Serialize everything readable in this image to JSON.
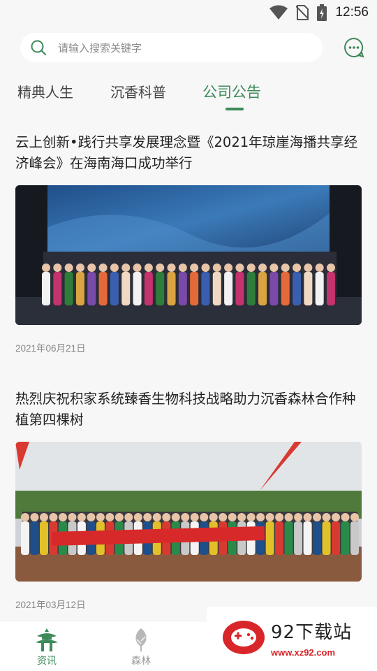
{
  "status_bar": {
    "time": "12:56",
    "icons": [
      "wifi-icon",
      "no-sim-icon",
      "battery-icon"
    ]
  },
  "search": {
    "placeholder": "请输入搜索关键字"
  },
  "tabs": [
    {
      "label": "精典人生",
      "active": false
    },
    {
      "label": "沉香科普",
      "active": false
    },
    {
      "label": "公司公告",
      "active": true
    }
  ],
  "articles": [
    {
      "title": "云上创新•践行共享发展理念暨《2021年琼崖海播共享经济峰会》在海南海口成功举行",
      "date": "2021年06月21日",
      "image": "conference-group-photo"
    },
    {
      "title": "热烈庆祝积家系统臻香生物科技战略助力沉香森林合作种植第四棵树",
      "date": "2021年03月12日",
      "image": "plantation-group-photo"
    }
  ],
  "bottom_nav": [
    {
      "label": "资讯",
      "icon": "pagoda-icon",
      "active": true
    },
    {
      "label": "森林",
      "icon": "tree-icon",
      "active": false
    }
  ],
  "watermark": {
    "title": "92下载站",
    "url": "www.xz92.com"
  },
  "colors": {
    "accent": "#3d8a5a",
    "background": "#f7f7f7",
    "watermark_red": "#d8262a"
  }
}
